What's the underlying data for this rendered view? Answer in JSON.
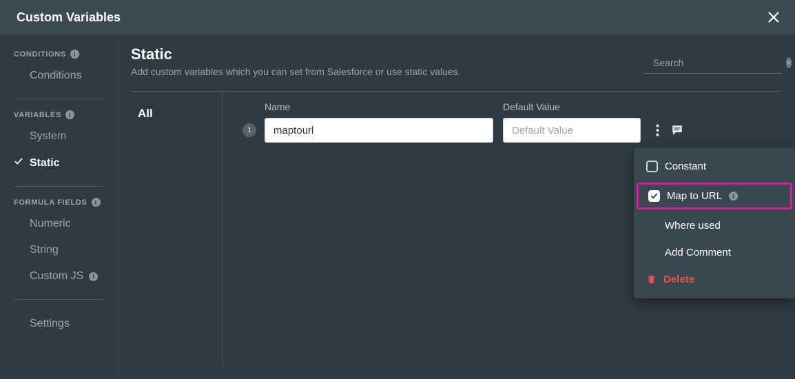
{
  "header": {
    "title": "Custom Variables"
  },
  "sidebar": {
    "sections": [
      {
        "label": "CONDITIONS",
        "items": [
          {
            "label": "Conditions",
            "selected": false
          }
        ]
      },
      {
        "label": "VARIABLES",
        "items": [
          {
            "label": "System",
            "selected": false
          },
          {
            "label": "Static",
            "selected": true
          }
        ]
      },
      {
        "label": "FORMULA FIELDS",
        "items": [
          {
            "label": "Numeric",
            "selected": false
          },
          {
            "label": "String",
            "selected": false
          },
          {
            "label": "Custom JS",
            "selected": false,
            "badge": true
          }
        ]
      }
    ],
    "footer": {
      "label": "Settings"
    }
  },
  "main": {
    "title": "Static",
    "subtitle": "Add custom variables which you can set from Salesforce or use static values.",
    "search_placeholder": "Search",
    "filter": {
      "all_label": "All"
    },
    "columns": {
      "name": "Name",
      "default": "Default Value"
    },
    "rows": [
      {
        "num": "1",
        "name": "maptourl",
        "default": "",
        "default_placeholder": "Default Value"
      }
    ]
  },
  "menu": {
    "constant": "Constant",
    "map_to_url": "Map to URL",
    "where_used": "Where used",
    "add_comment": "Add Comment",
    "delete": "Delete"
  }
}
